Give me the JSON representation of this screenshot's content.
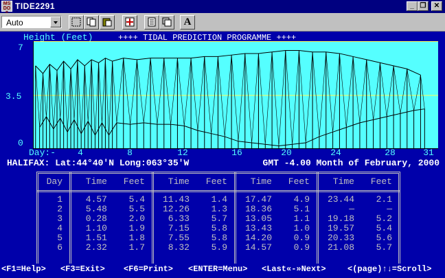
{
  "window": {
    "title": "TIDE2291",
    "app_icon_text": "MS DO S",
    "minimize_label": "_",
    "restore_label": "❐",
    "close_label": "✕"
  },
  "toolbar": {
    "font_value": "Auto",
    "items": [
      "mark-icon",
      "copy-icon",
      "paste-icon",
      "fullscreen-icon",
      "properties-icon",
      "background-icon",
      "font-icon"
    ],
    "font_button_label": "A"
  },
  "chart_header": {
    "left": "Height (Feet)",
    "center": "++++ TIDAL PREDICTION PROGRAMME ++++"
  },
  "y_axis": {
    "ticks": [
      "7",
      "3.5",
      "0"
    ]
  },
  "x_axis": {
    "label": "Day:-",
    "ticks": [
      "4",
      "8",
      "12",
      "16",
      "20",
      "24",
      "28",
      "31"
    ]
  },
  "info": {
    "location": "HALIFAX: Lat:44°40'N Long:063°35'W",
    "gmt": "GMT -4.00 Month of February, 2000"
  },
  "table": {
    "headers": [
      "Day",
      "Time",
      "Feet",
      "Time",
      "Feet",
      "Time",
      "Feet",
      "Time",
      "Feet"
    ],
    "rows": [
      [
        "1",
        "4.57",
        "5.4",
        "11.43",
        "1.4",
        "17.47",
        "4.9",
        "23.44",
        "2.1"
      ],
      [
        "2",
        "5.48",
        "5.5",
        "12.26",
        "1.3",
        "18.36",
        "5.1",
        "—",
        "—"
      ],
      [
        "3",
        "0.28",
        "2.0",
        "6.33",
        "5.7",
        "13.05",
        "1.1",
        "19.18",
        "5.2"
      ],
      [
        "4",
        "1.10",
        "1.9",
        "7.15",
        "5.8",
        "13.43",
        "1.0",
        "19.57",
        "5.4"
      ],
      [
        "5",
        "1.51",
        "1.8",
        "7.55",
        "5.8",
        "14.20",
        "0.9",
        "20.33",
        "5.6"
      ],
      [
        "6",
        "2.32",
        "1.7",
        "8.32",
        "5.9",
        "14.57",
        "0.9",
        "21.08",
        "5.7"
      ]
    ]
  },
  "function_keys": [
    "<F1=Help>",
    "<F3=Exit>",
    "<F6=Print>",
    "<ENTER=Menu>",
    "<Last«-»Next>",
    "<(page)↑↓=Scroll>"
  ],
  "colors": {
    "screen_bg": "#0000aa",
    "chart_bg": "#55ffff",
    "chart_line": "#000000",
    "grid_line": "#ffff55",
    "text_cyan": "#55ffff",
    "text_gray": "#c0c0c0"
  },
  "chart_data": {
    "type": "line",
    "title": "++++ TIDAL PREDICTION PROGRAMME ++++",
    "ylabel": "Height (Feet)",
    "xlabel": "Day:-",
    "ylim": [
      0,
      7
    ],
    "xlim": [
      1,
      31
    ],
    "x_ticks": [
      4,
      8,
      12,
      16,
      20,
      24,
      28,
      31
    ],
    "y_ticks": [
      0,
      3.5,
      7
    ],
    "grid": "horizontal",
    "series": [
      {
        "values": [
          [
            1.19,
            5.4
          ],
          [
            1.49,
            1.4
          ],
          [
            1.74,
            4.9
          ],
          [
            1.99,
            2.1
          ],
          [
            2.24,
            5.5
          ],
          [
            2.52,
            1.3
          ],
          [
            2.78,
            5.1
          ],
          [
            3.02,
            2.0
          ],
          [
            3.27,
            5.7
          ],
          [
            3.55,
            1.1
          ],
          [
            3.8,
            5.2
          ],
          [
            4.05,
            1.9
          ],
          [
            4.3,
            5.8
          ],
          [
            4.57,
            1.0
          ],
          [
            4.83,
            5.4
          ],
          [
            5.08,
            1.8
          ],
          [
            5.33,
            5.8
          ],
          [
            5.6,
            0.9
          ],
          [
            5.86,
            5.6
          ],
          [
            6.11,
            1.7
          ],
          [
            6.36,
            5.9
          ],
          [
            6.62,
            0.9
          ],
          [
            6.88,
            5.7
          ],
          [
            7.2,
            1.7
          ],
          [
            7.7,
            5.9
          ],
          [
            8.2,
            1.6
          ],
          [
            8.7,
            5.8
          ],
          [
            9.2,
            1.7
          ],
          [
            9.7,
            5.9
          ],
          [
            10.2,
            1.6
          ],
          [
            10.7,
            5.9
          ],
          [
            11.2,
            1.6
          ],
          [
            11.7,
            5.9
          ],
          [
            12.2,
            1.5
          ],
          [
            12.7,
            5.9
          ],
          [
            13.2,
            1.2
          ],
          [
            13.7,
            6.0
          ],
          [
            14.2,
            1.0
          ],
          [
            14.7,
            6.0
          ],
          [
            15.2,
            0.8
          ],
          [
            15.7,
            6.1
          ],
          [
            16.2,
            0.5
          ],
          [
            16.7,
            6.2
          ],
          [
            17.2,
            0.4
          ],
          [
            17.7,
            6.2
          ],
          [
            18.2,
            0.3
          ],
          [
            18.7,
            6.3
          ],
          [
            19.2,
            0.2
          ],
          [
            19.7,
            6.4
          ],
          [
            20.2,
            0.3
          ],
          [
            20.7,
            6.4
          ],
          [
            21.2,
            0.4
          ],
          [
            21.7,
            6.3
          ],
          [
            22.2,
            0.8
          ],
          [
            22.7,
            6.3
          ],
          [
            23.2,
            1.1
          ],
          [
            23.7,
            6.2
          ],
          [
            24.2,
            1.4
          ],
          [
            24.7,
            6.0
          ],
          [
            25.2,
            1.7
          ],
          [
            25.7,
            5.8
          ],
          [
            26.2,
            1.9
          ],
          [
            26.7,
            5.6
          ],
          [
            27.2,
            2.1
          ],
          [
            27.7,
            5.4
          ],
          [
            28.2,
            2.3
          ],
          [
            28.7,
            5.2
          ],
          [
            29.2,
            2.5
          ],
          [
            29.7,
            4.8
          ],
          [
            30.0,
            2.6
          ]
        ]
      }
    ]
  }
}
